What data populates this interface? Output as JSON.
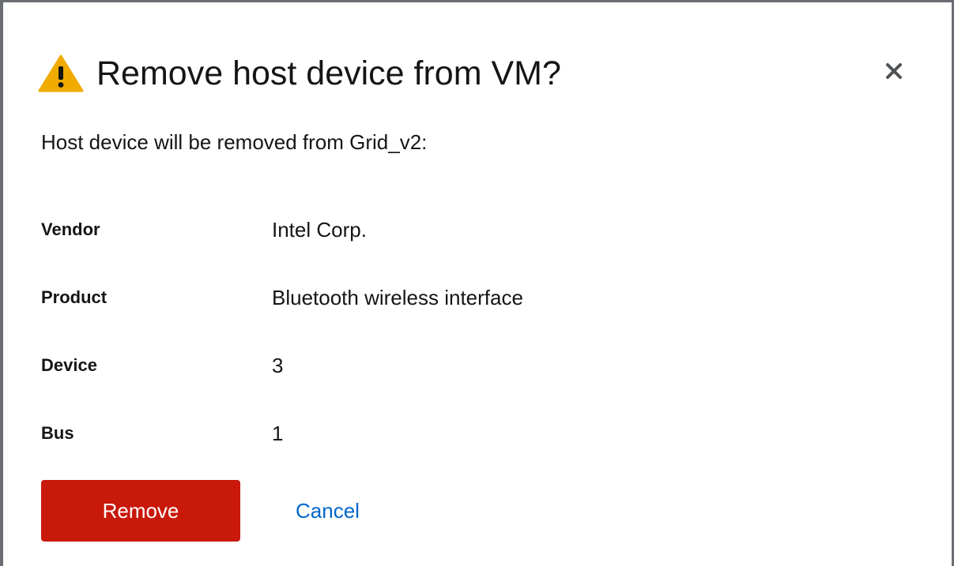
{
  "dialog": {
    "title": "Remove host device from VM?",
    "message": "Host device will be removed from Grid_v2:",
    "icons": {
      "title_icon": "warning-triangle-icon",
      "close_icon": "close-icon"
    },
    "colors": {
      "warning": "#f0ab00",
      "danger": "#c9190b",
      "link": "#0066cc"
    },
    "details": [
      {
        "label": "Vendor",
        "value": "Intel Corp."
      },
      {
        "label": "Product",
        "value": "Bluetooth wireless interface"
      },
      {
        "label": "Device",
        "value": "3"
      },
      {
        "label": "Bus",
        "value": "1"
      }
    ],
    "actions": {
      "remove_label": "Remove",
      "cancel_label": "Cancel"
    }
  }
}
